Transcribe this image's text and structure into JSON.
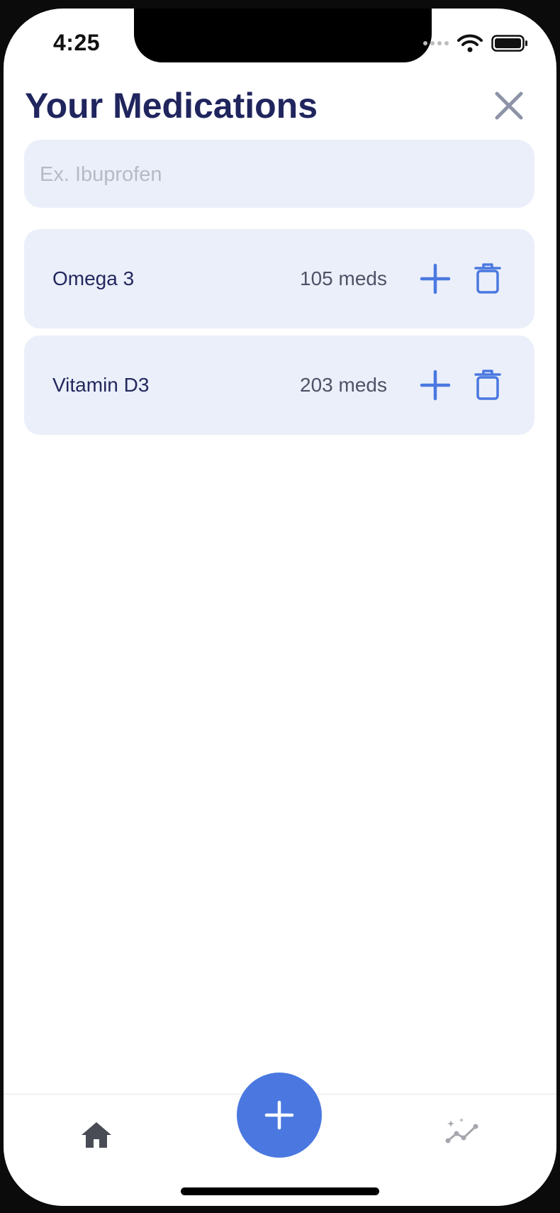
{
  "status_bar": {
    "time": "4:25"
  },
  "header": {
    "title": "Your Medications"
  },
  "search": {
    "placeholder": "Ex. Ibuprofen",
    "value": ""
  },
  "medications": [
    {
      "name": "Omega 3",
      "count": "105 meds"
    },
    {
      "name": "Vitamin D3",
      "count": "203 meds"
    }
  ],
  "icons": {
    "close": "close-icon",
    "add_dose": "plus-icon",
    "delete": "trash-icon",
    "home": "home-icon",
    "insights": "sparkle-chart-icon",
    "fab": "plus-icon"
  },
  "colors": {
    "title": "#20255e",
    "accent": "#4a78e0",
    "card_background": "#ebeffa",
    "muted_text": "#4f5266",
    "placeholder": "#b6bac6"
  }
}
